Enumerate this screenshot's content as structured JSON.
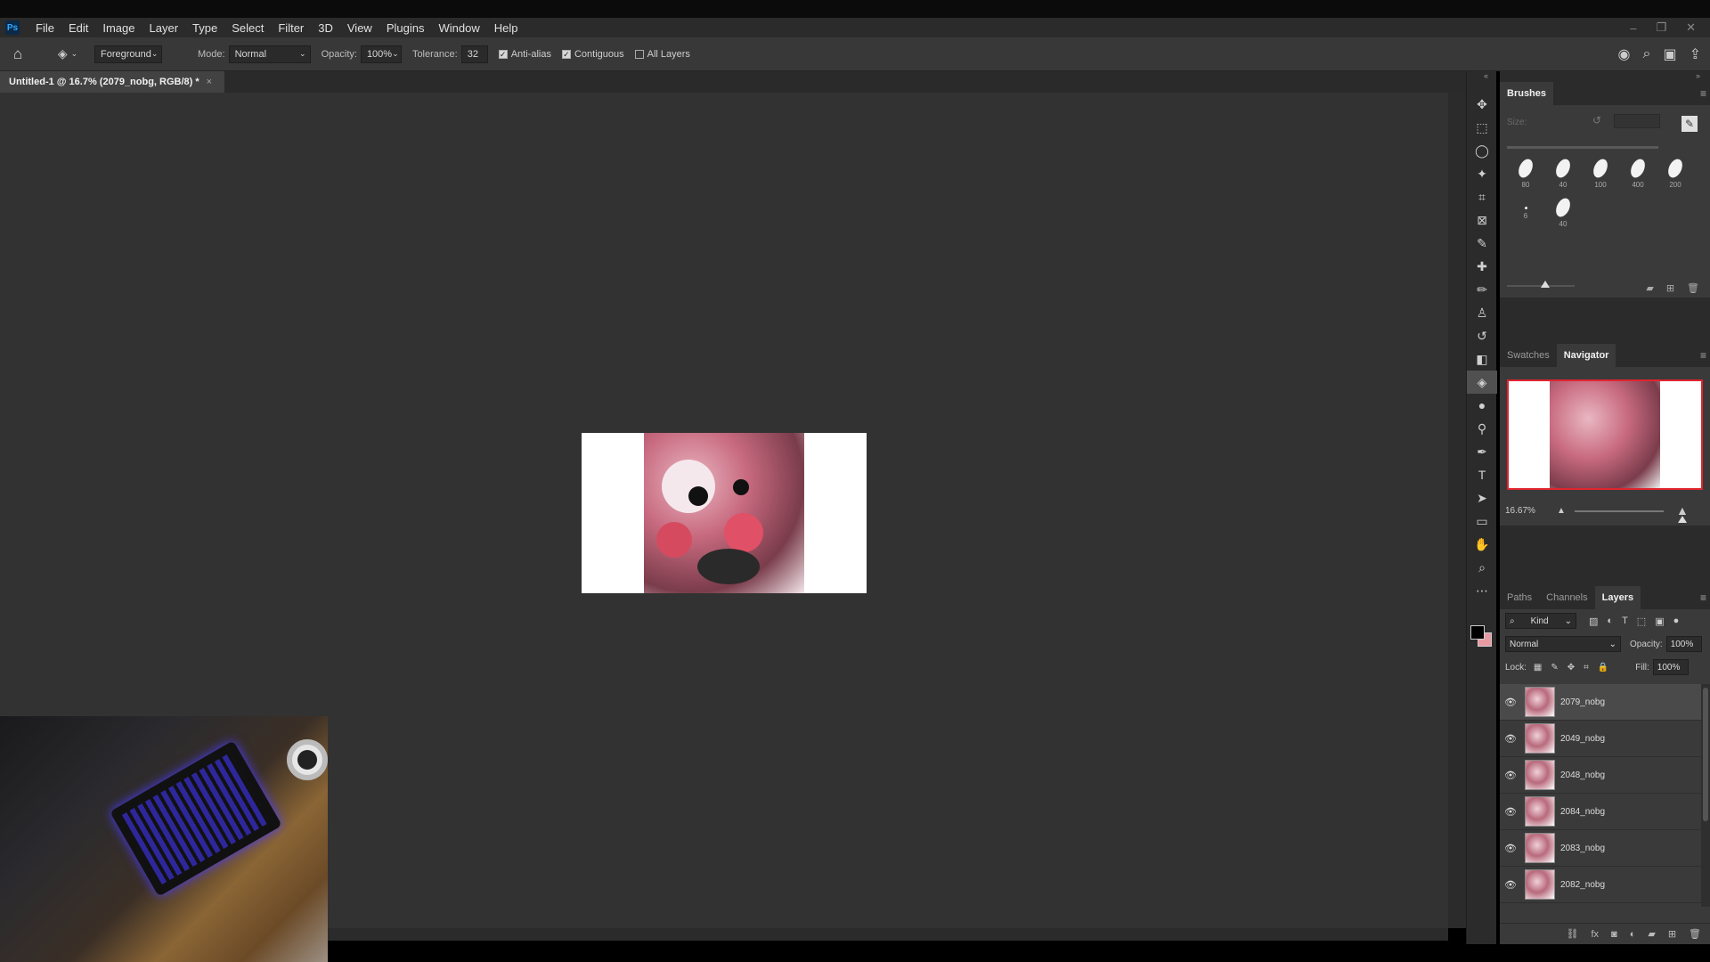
{
  "app": {
    "logo": "Ps",
    "menu": [
      "File",
      "Edit",
      "Image",
      "Layer",
      "Type",
      "Select",
      "Filter",
      "3D",
      "View",
      "Plugins",
      "Window",
      "Help"
    ],
    "window_controls": [
      "–",
      "❐",
      "✕"
    ]
  },
  "options": {
    "fill_source": "Foreground",
    "mode_label": "Mode:",
    "mode_value": "Normal",
    "opacity_label": "Opacity:",
    "opacity_value": "100%",
    "tolerance_label": "Tolerance:",
    "tolerance_value": "32",
    "anti_alias": "Anti-alias",
    "contiguous": "Contiguous",
    "all_layers": "All Layers"
  },
  "document": {
    "tab_title": "Untitled-1 @ 16.7% (2079_nobg, RGB/8) *",
    "close": "×"
  },
  "brushes": {
    "tab": "Brushes",
    "size_label": "Size:",
    "presets": [
      "80",
      "40",
      "100",
      "400",
      "200",
      "6",
      "40"
    ]
  },
  "navigator": {
    "tabs": [
      "Swatches",
      "Navigator"
    ],
    "zoom": "16.67%"
  },
  "layers": {
    "tabs": [
      "Paths",
      "Channels",
      "Layers"
    ],
    "kind_label": "Kind",
    "blend_mode": "Normal",
    "opacity_label": "Opacity:",
    "opacity_value": "100%",
    "lock_label": "Lock:",
    "fill_label": "Fill:",
    "fill_value": "100%",
    "items": [
      {
        "name": "2079_nobg"
      },
      {
        "name": "2049_nobg"
      },
      {
        "name": "2048_nobg"
      },
      {
        "name": "2084_nobg"
      },
      {
        "name": "2083_nobg"
      },
      {
        "name": "2082_nobg"
      }
    ]
  },
  "colors": {
    "foreground": "#000000",
    "background": "#e89aa2",
    "navigator_frame": "#e0242f"
  }
}
